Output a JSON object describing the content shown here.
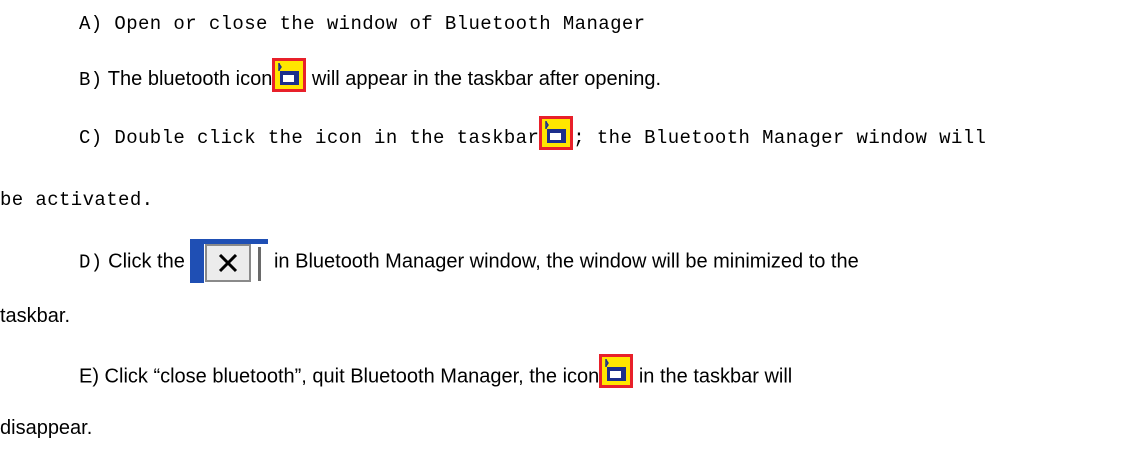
{
  "items": {
    "a": {
      "text": "A) Open or close the window of Bluetooth Manager"
    },
    "b": {
      "prefix": "B)",
      "before_icon": " The bluetooth icon",
      "icon": "bluetooth-tray-icon",
      "after_icon": " will appear in the taskbar after opening."
    },
    "c": {
      "before_icon": "C) Double click the icon in the taskbar",
      "icon": "bluetooth-tray-icon",
      "after_icon": "; the Bluetooth Manager window will",
      "continuation": "be activated."
    },
    "d": {
      "prefix": "D)",
      "before_icon": " Click the ",
      "icon": "close-icon",
      "after_icon": " in Bluetooth Manager window, the window will be minimized to the",
      "continuation": "taskbar."
    },
    "e": {
      "before_icon": "E) Click “close bluetooth”, quit Bluetooth Manager, the icon",
      "icon": "bluetooth-tray-icon",
      "after_icon": " in the taskbar will",
      "continuation": "disappear."
    }
  },
  "colors": {
    "icon_border": "#e8202a",
    "icon_bg": "#ffe600",
    "icon_blue": "#1c2f8c",
    "close_blue": "#1f4fb4"
  }
}
